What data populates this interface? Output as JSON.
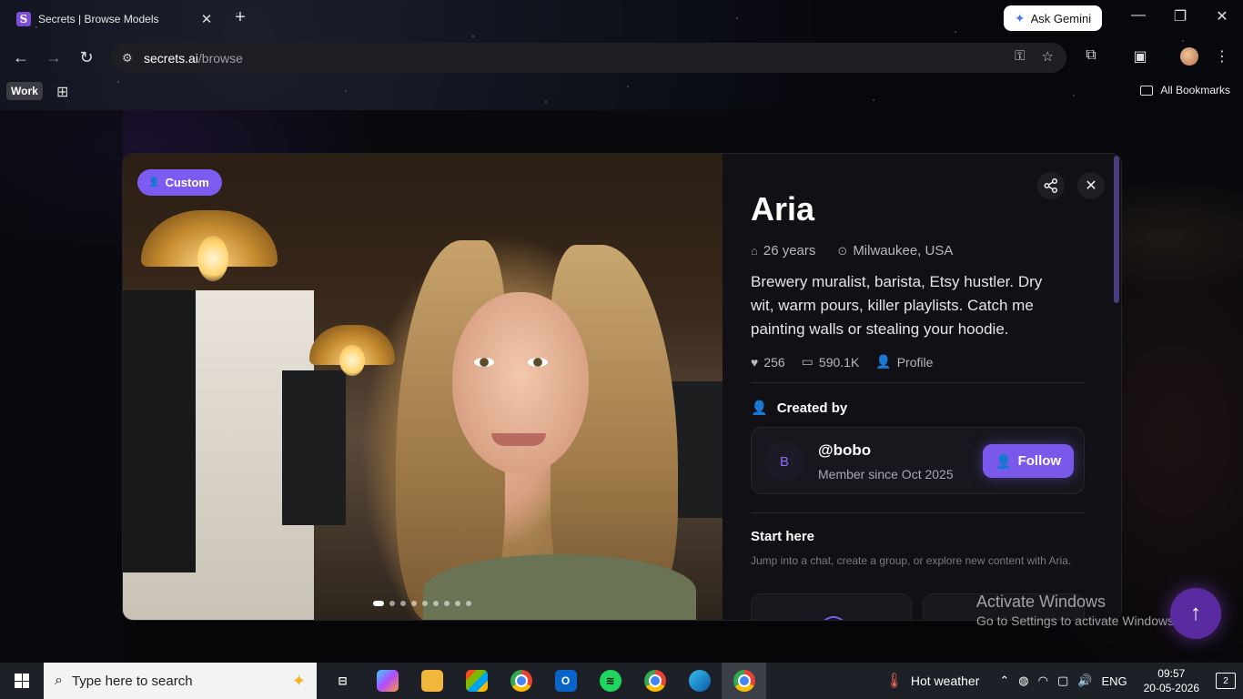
{
  "browser": {
    "tab": {
      "title": "Secrets | Browse Models",
      "favicon_letter": "S"
    },
    "new_tab": "+",
    "ask_gemini": "Ask Gemini",
    "window_controls": {
      "minimize": "—",
      "restore": "❐",
      "close": "✕"
    },
    "url": {
      "host": "secrets.ai",
      "path": "/browse"
    },
    "bookmarks_bar": {
      "work_chip": "Work",
      "all_bookmarks": "All Bookmarks"
    }
  },
  "modal": {
    "badge": "Custom",
    "carousel": {
      "count": 9,
      "active_index": 0
    },
    "name": "Aria",
    "age": "26 years",
    "location": "Milwaukee, USA",
    "bio": "Brewery muralist, barista, Etsy hustler. Dry wit, warm pours, killer playlists. Catch me painting walls or stealing your hoodie.",
    "stats": {
      "likes": "256",
      "messages": "590.1K",
      "profile_label": "Profile"
    },
    "created_by_label": "Created by",
    "creator": {
      "avatar_letter": "B",
      "handle": "@bobo",
      "member_since": "Member since Oct 2025",
      "follow_label": "Follow"
    },
    "start_here": {
      "title": "Start here",
      "description": "Jump into a chat, create a group, or explore new content with Aria."
    }
  },
  "watermark": {
    "title": "Activate Windows",
    "subtitle": "Go to Settings to activate Windows."
  },
  "taskbar": {
    "search_placeholder": "Type here to search",
    "weather": "Hot weather",
    "language": "ENG",
    "time": "09:57",
    "date": "20-05-2026",
    "notification_count": "2"
  }
}
